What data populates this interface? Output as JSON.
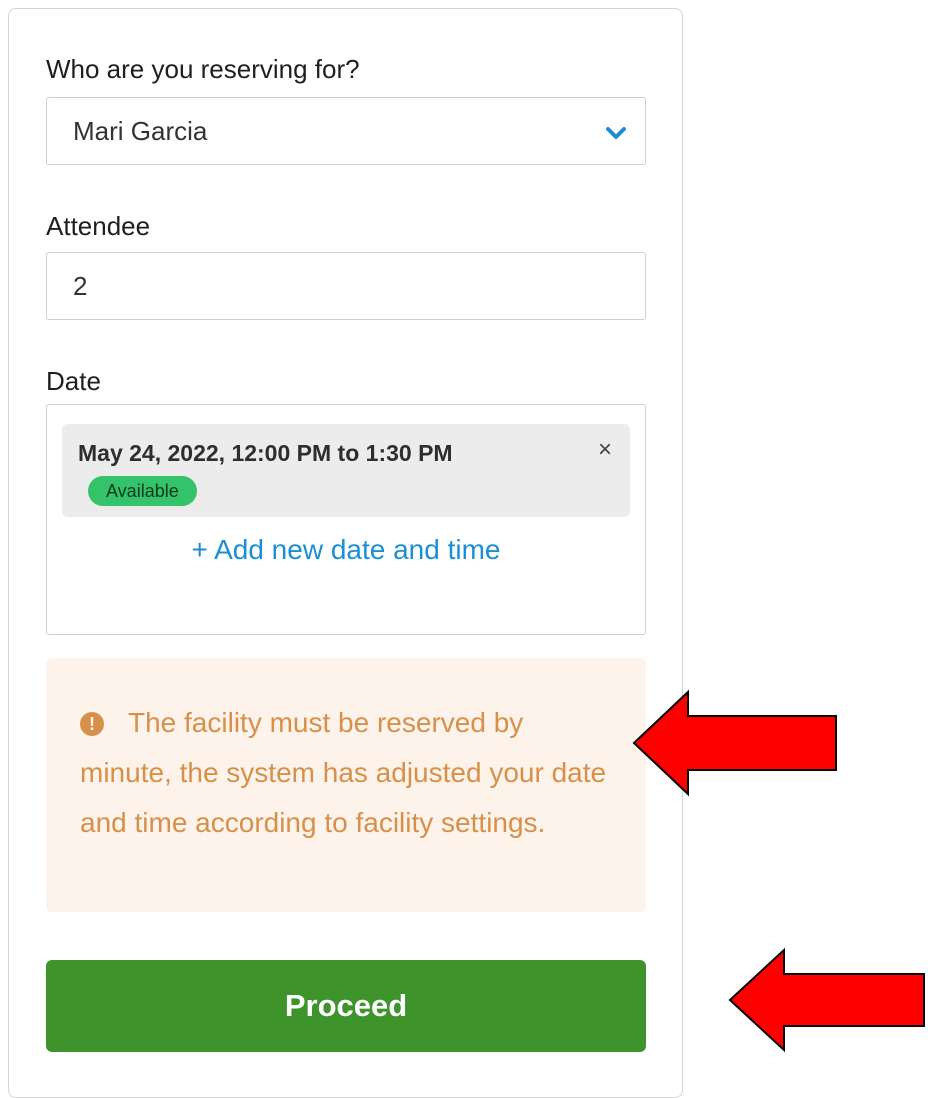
{
  "form": {
    "reserving_for_label": "Who are you reserving for?",
    "reserving_for_value": "Mari Garcia",
    "attendee_label": "Attendee",
    "attendee_value": "2",
    "date_label": "Date",
    "date_entry": {
      "text": "May 24, 2022, 12:00 PM to 1:30 PM",
      "status": "Available",
      "remove_glyph": "×"
    },
    "add_date_link": "+ Add new date and time",
    "alert": {
      "icon_glyph": "!",
      "message": "The facility must be reserved by minute, the system has adjusted your date and time according to facility settings."
    },
    "proceed_label": "Proceed"
  },
  "icons": {
    "dropdown": "chevron-down-icon",
    "remove": "close-icon",
    "alert": "exclamation-circle-icon",
    "annotation": "red-arrow-icon"
  },
  "colors": {
    "accent_blue": "#1b8fd6",
    "available_green": "#34c26a",
    "alert_text": "#d7904a",
    "alert_bg": "#fdf3ea",
    "proceed_green": "#3f932b",
    "annotation_red": "#ff0000"
  }
}
